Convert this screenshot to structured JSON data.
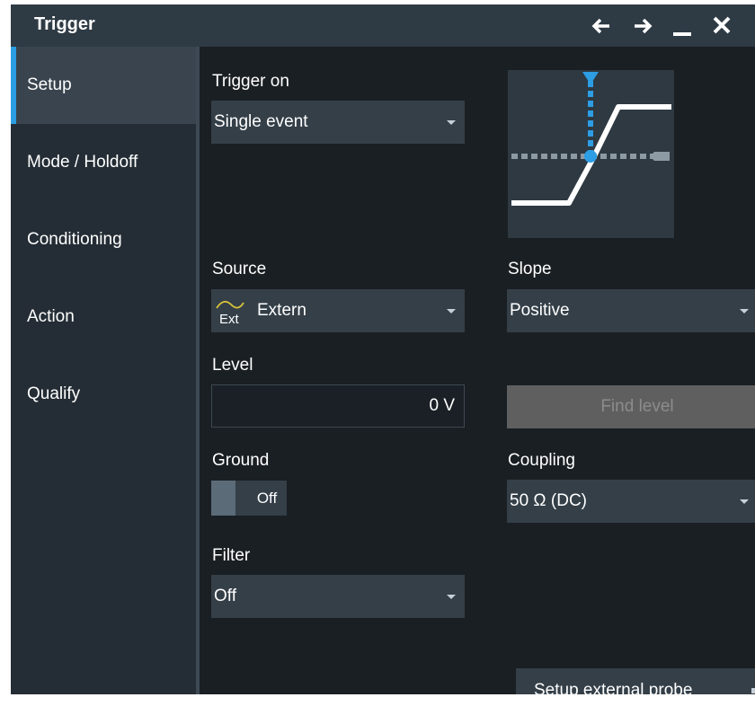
{
  "window": {
    "title": "Trigger",
    "icons": [
      "arrow-left-icon",
      "arrow-right-icon",
      "minimize-icon",
      "close-icon"
    ]
  },
  "sidebar": {
    "items": [
      {
        "label": "Setup",
        "active": true
      },
      {
        "label": "Mode / Holdoff",
        "active": false
      },
      {
        "label": "Conditioning",
        "active": false
      },
      {
        "label": "Action",
        "active": false
      },
      {
        "label": "Qualify",
        "active": false
      }
    ]
  },
  "form": {
    "trigger_on": {
      "label": "Trigger on",
      "value": "Single event"
    },
    "source": {
      "label": "Source",
      "value": "Extern",
      "icon_text": "Ext"
    },
    "slope": {
      "label": "Slope",
      "value": "Positive"
    },
    "level": {
      "label": "Level",
      "value": "0 V"
    },
    "find_level": {
      "label": "Find level",
      "enabled": false
    },
    "ground": {
      "label": "Ground",
      "state": "Off"
    },
    "coupling": {
      "label": "Coupling",
      "value": "50 Ω (DC)"
    },
    "filter": {
      "label": "Filter",
      "value": "Off"
    },
    "probe_button": {
      "label": "Setup external probe"
    }
  },
  "colors": {
    "accent": "#2d9de4",
    "background": "#1a1f23",
    "panel": "#242d35",
    "control": "#343f48"
  }
}
